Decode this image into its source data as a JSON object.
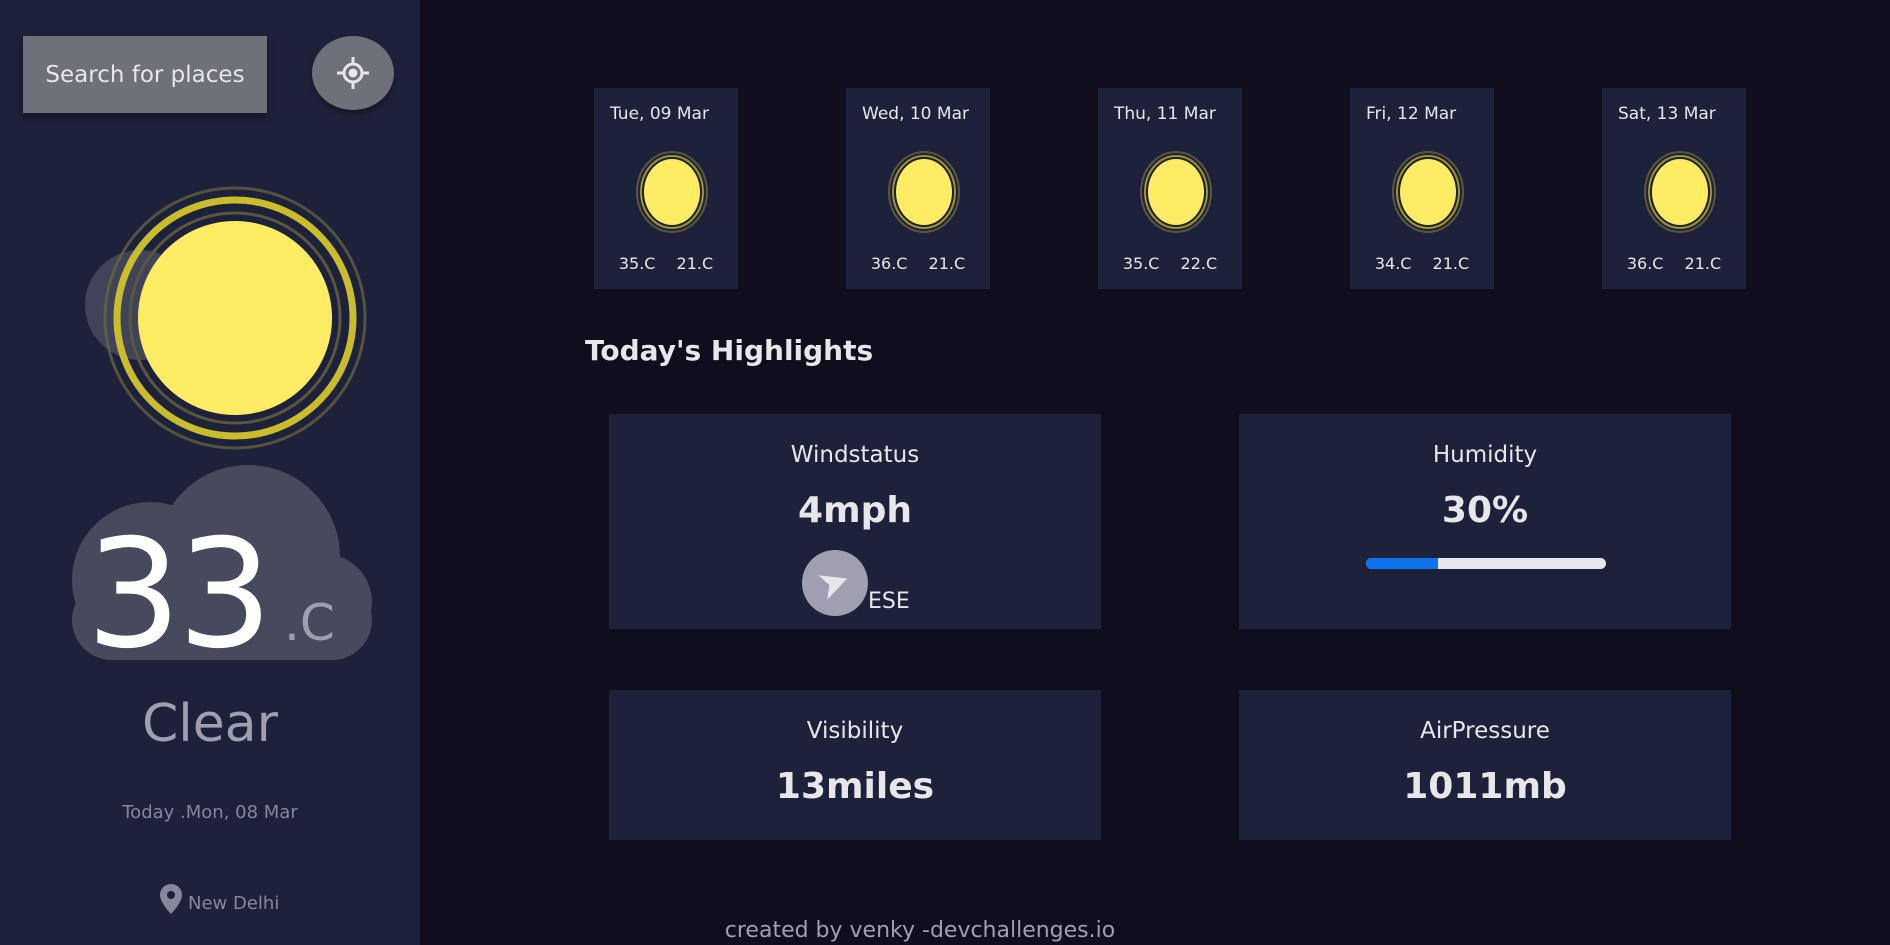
{
  "sidebar": {
    "search_label": "Search for places",
    "temperature": "33",
    "temperature_unit": ".C",
    "condition": "Clear",
    "date": "Today .Mon, 08 Mar",
    "location": "New Delhi"
  },
  "forecast": [
    {
      "day": "Tue, 09 Mar",
      "max": "35.C",
      "min": "21.C",
      "icon": "sun-icon"
    },
    {
      "day": "Wed, 10 Mar",
      "max": "36.C",
      "min": "21.C",
      "icon": "sun-icon"
    },
    {
      "day": "Thu, 11 Mar",
      "max": "35.C",
      "min": "22.C",
      "icon": "sun-icon"
    },
    {
      "day": "Fri, 12 Mar",
      "max": "34.C",
      "min": "21.C",
      "icon": "sun-icon"
    },
    {
      "day": "Sat, 13 Mar",
      "max": "36.C",
      "min": "21.C",
      "icon": "sun-icon"
    }
  ],
  "highlights": {
    "title": "Today's Highlights",
    "wind": {
      "label": "Windstatus",
      "value": "4mph",
      "direction": "ESE"
    },
    "humidity": {
      "label": "Humidity",
      "value": "30%",
      "percent": 30
    },
    "visibility": {
      "label": "Visibility",
      "value": "13miles"
    },
    "air_pressure": {
      "label": "AirPressure",
      "value": "1011mb"
    }
  },
  "footer": "created by venky -devchallenges.io",
  "colors": {
    "sidebar_bg": "#1e213a",
    "main_bg": "#100e1d",
    "sun": "#ffec65",
    "humidity_fill": "#0e72ed"
  }
}
